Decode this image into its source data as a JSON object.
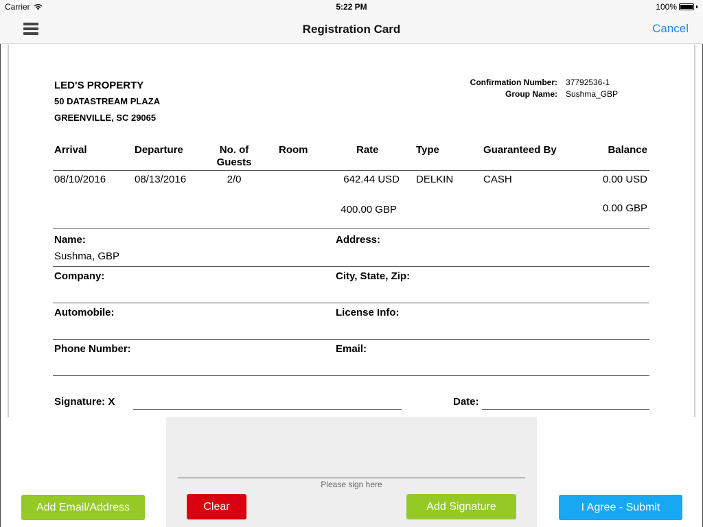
{
  "status_bar": {
    "carrier": "Carrier",
    "time": "5:22 PM",
    "battery": "100%",
    "battery_level": 1.0
  },
  "nav": {
    "title": "Registration Card",
    "cancel_label": "Cancel",
    "menu_icon": "hamburger-menu-icon"
  },
  "property": {
    "name": "LED'S PROPERTY",
    "address_line1": "50 DATASTREAM PLAZA",
    "address_line2": "GREENVILLE, SC 29065"
  },
  "reservation": {
    "confirmation_label": "Confirmation Number:",
    "confirmation_number": "37792536-1",
    "group_label": "Group Name:",
    "group_name": "Sushma_GBP"
  },
  "table": {
    "headers": {
      "arrival": "Arrival",
      "departure": "Departure",
      "guests_line1": "No. of",
      "guests_line2": "Guests",
      "room": "Room",
      "rate": "Rate",
      "type": "Type",
      "guaranteed_by": "Guaranteed By",
      "balance": "Balance"
    },
    "row": {
      "arrival": "08/10/2016",
      "departure": "08/13/2016",
      "guests": "2/0",
      "room": "",
      "rate_usd": "642.44 USD",
      "rate_gbp": "400.00 GBP",
      "type": "DELKIN",
      "guaranteed_by": "CASH",
      "balance_usd": "0.00 USD",
      "balance_gbp": "0.00 GBP"
    }
  },
  "guest_fields": {
    "name_label": "Name:",
    "name_value": "Sushma, GBP",
    "address_label": "Address:",
    "address_value": "",
    "company_label": "Company:",
    "company_value": "",
    "city_label": "City, State, Zip:",
    "city_value": "",
    "automobile_label": "Automobile:",
    "automobile_value": "",
    "license_label": "License Info:",
    "license_value": "",
    "phone_label": "Phone Number:",
    "phone_value": "",
    "email_label": "Email:",
    "email_value": ""
  },
  "signature": {
    "signature_label": "Signature: X",
    "date_label": "Date:",
    "pad_hint": "Please sign here"
  },
  "buttons": {
    "add_email": "Add Email/Address",
    "clear": "Clear",
    "add_signature": "Add Signature",
    "submit": "I Agree - Submit"
  },
  "colors": {
    "accent_blue": "#1a8cf0",
    "green_button": "#94c926",
    "red_button": "#d9000f",
    "submit_button": "#18a7f2",
    "signature_pad_bg": "#eeeeee"
  }
}
